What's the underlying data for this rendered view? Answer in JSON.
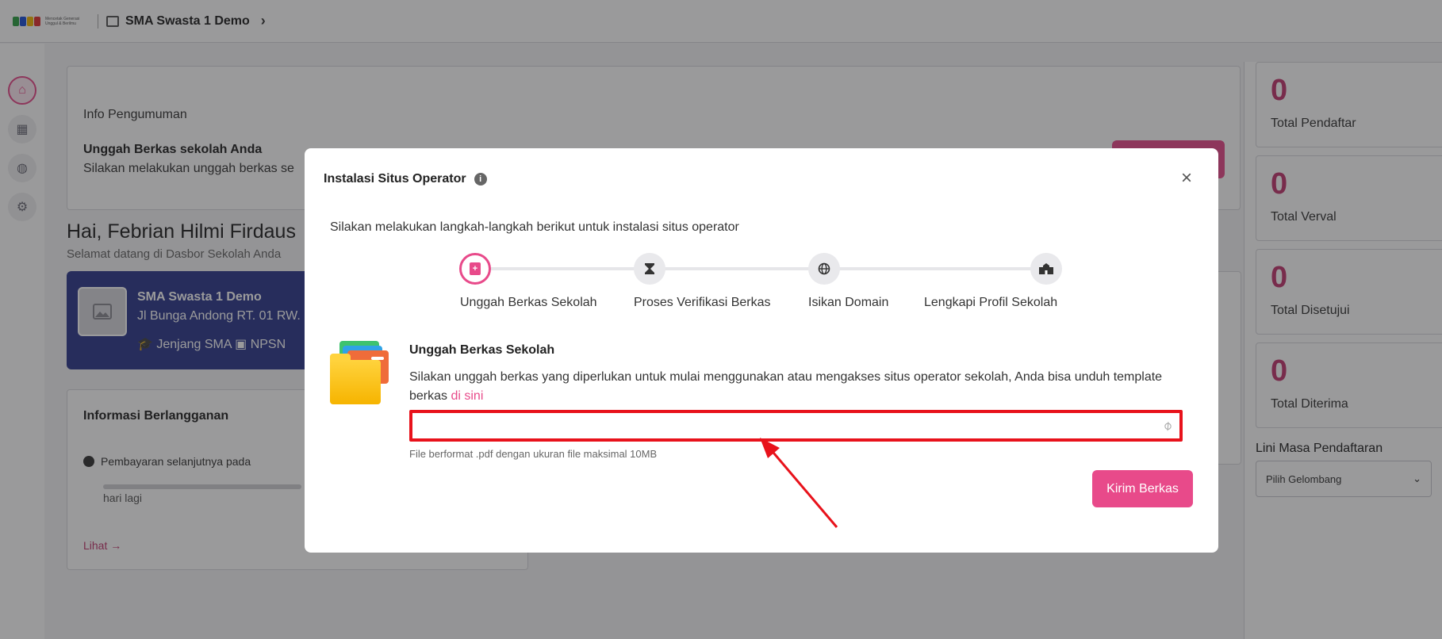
{
  "brand": {
    "tagline": "Mencetak Generasi Unggul & Berilmu"
  },
  "topbar": {
    "school_name": "SMA Swasta 1 Demo"
  },
  "announcement": {
    "label": "Info Pengumuman",
    "title": "Unggah Berkas sekolah Anda",
    "description": "Silakan melakukan unggah berkas se"
  },
  "greeting": {
    "title": "Hai, Febrian Hilmi Firdaus",
    "subtitle": "Selamat datang di Dasbor Sekolah Anda"
  },
  "school_card": {
    "name": "SMA Swasta 1 Demo",
    "address": "Jl Bunga Andong RT. 01 RW.",
    "level": "Jenjang SMA",
    "npsn": "NPSN"
  },
  "subscription": {
    "title": "Informasi Berlangganan",
    "next_payment": "Pembayaran selanjutnya pada",
    "days_left": "hari lagi",
    "link": "Lihat"
  },
  "stats": [
    {
      "value": "0",
      "label": "Total Pendaftar"
    },
    {
      "value": "0",
      "label": "Total Verval"
    },
    {
      "value": "0",
      "label": "Total Disetujui"
    },
    {
      "value": "0",
      "label": "Total Diterima"
    }
  ],
  "timeline": {
    "title": "Lini Masa Pendaftaran",
    "select_value": "Pilih Gelombang"
  },
  "modal": {
    "title": "Instalasi Situs Operator",
    "intro": "Silakan melakukan langkah-langkah berikut untuk instalasi situs operator",
    "steps": [
      {
        "label": "Unggah Berkas Sekolah",
        "icon": "file-upload-icon"
      },
      {
        "label": "Proses Verifikasi Berkas",
        "icon": "hourglass-icon"
      },
      {
        "label": "Isikan Domain",
        "icon": "globe-icon"
      },
      {
        "label": "Lengkapi Profil Sekolah",
        "icon": "school-icon"
      }
    ],
    "upload": {
      "title": "Unggah Berkas Sekolah",
      "description": "Silakan unggah berkas yang diperlukan untuk mulai menggunakan atau mengakses situs operator sekolah, Anda bisa unduh template berkas ",
      "link": "di sini",
      "hint": "File berformat .pdf dengan ukuran file maksimal 10MB"
    },
    "submit_label": "Kirim Berkas"
  },
  "colors": {
    "accent": "#e84a8a",
    "highlight": "#e8121b",
    "school_card": "#2e3a8c"
  }
}
